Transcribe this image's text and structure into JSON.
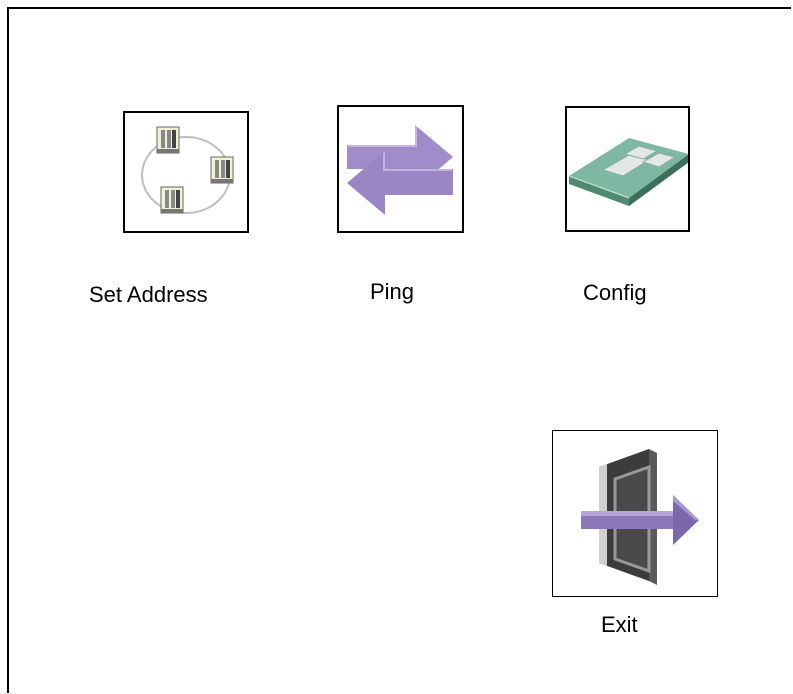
{
  "items": [
    {
      "label": "Set Address",
      "icon": "network-nodes-icon"
    },
    {
      "label": "Ping",
      "icon": "two-way-arrows-icon"
    },
    {
      "label": "Config",
      "icon": "circuit-board-icon"
    },
    {
      "label": "Exit",
      "icon": "exit-door-icon"
    }
  ],
  "colors": {
    "arrow_purple": "#a08cc8",
    "board_green": "#6aa890",
    "door_gray": "#555555"
  }
}
